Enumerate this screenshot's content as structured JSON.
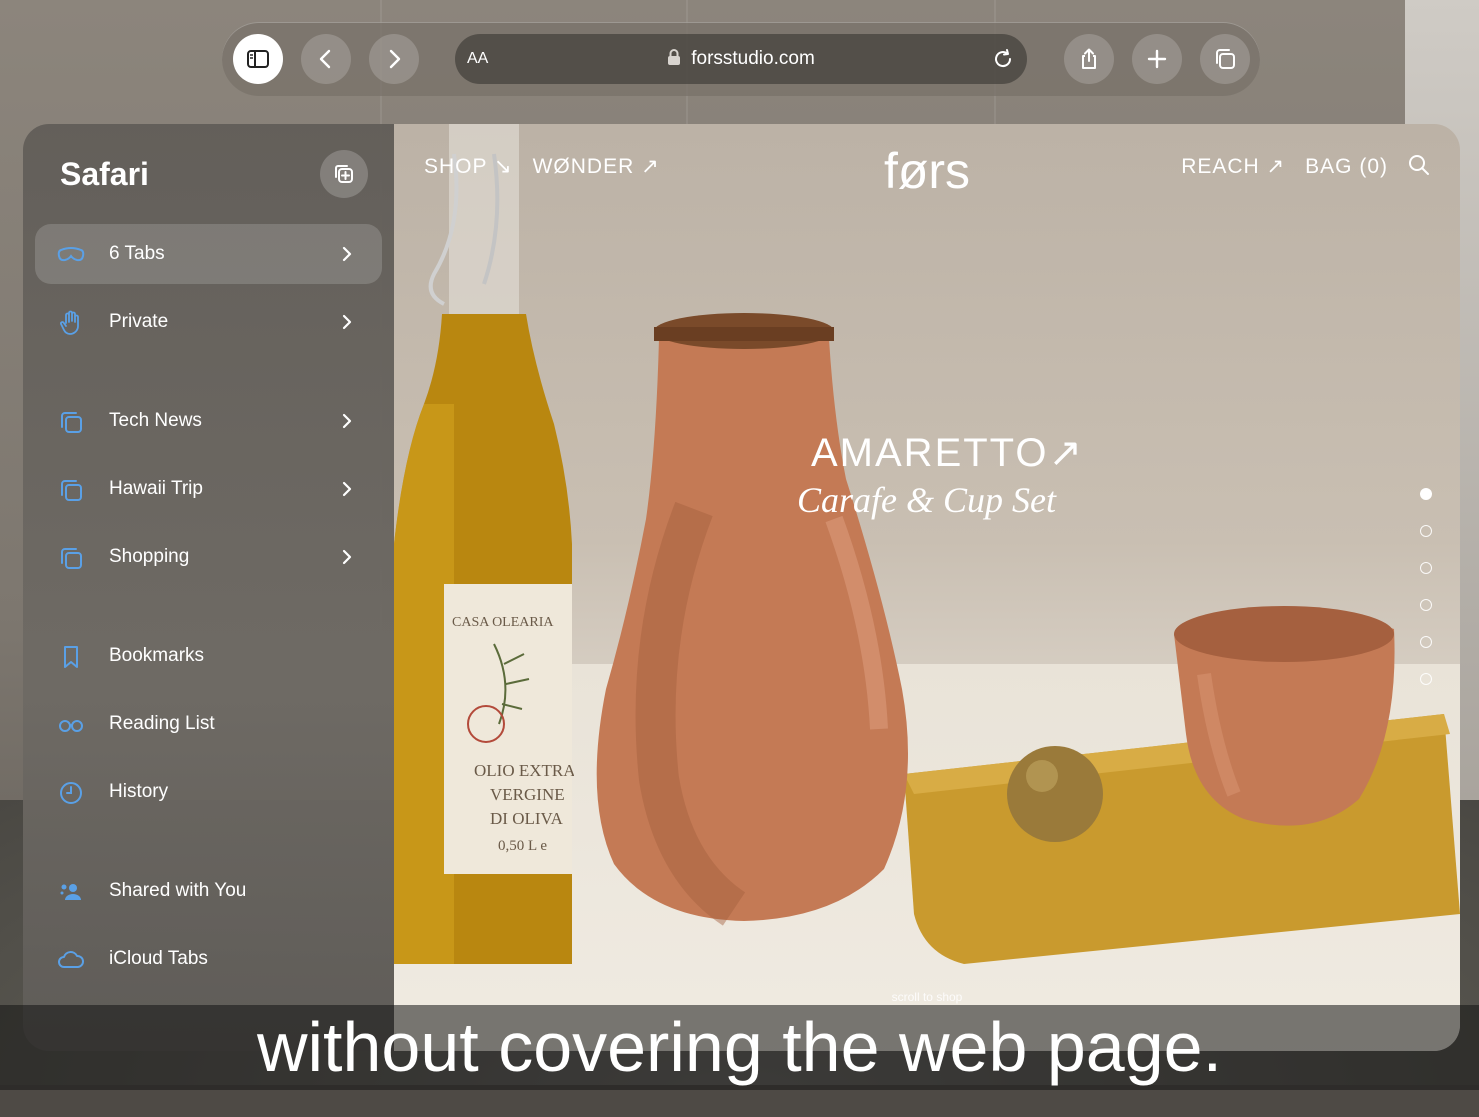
{
  "browser": {
    "address": {
      "text_size_label": "AA",
      "url": "forsstudio.com"
    }
  },
  "sidebar": {
    "title": "Safari",
    "items": [
      {
        "label": "6 Tabs",
        "icon": "vision-tabs-icon",
        "chevron": true
      },
      {
        "label": "Private",
        "icon": "hand-icon",
        "chevron": true
      },
      {
        "label": "Tech News",
        "icon": "tab-group-icon",
        "chevron": true
      },
      {
        "label": "Hawaii Trip",
        "icon": "tab-group-icon",
        "chevron": true
      },
      {
        "label": "Shopping",
        "icon": "tab-group-icon",
        "chevron": true
      },
      {
        "label": "Bookmarks",
        "icon": "bookmark-icon",
        "chevron": false
      },
      {
        "label": "Reading List",
        "icon": "glasses-icon",
        "chevron": false
      },
      {
        "label": "History",
        "icon": "clock-icon",
        "chevron": false
      },
      {
        "label": "Shared with You",
        "icon": "shared-people-icon",
        "chevron": false
      },
      {
        "label": "iCloud Tabs",
        "icon": "cloud-icon",
        "chevron": false
      }
    ]
  },
  "site": {
    "nav_left": [
      "SHOP ↘",
      "WØNDER ↗"
    ],
    "logo": "førs",
    "nav_right": [
      "REACH ↗",
      "BAG (0)"
    ],
    "hero_title": "AMARETTO↗",
    "hero_subtitle": "Carafe & Cup Set",
    "bottle_label_lines": [
      "CASA OLEARIA",
      "OLIO EXTRA",
      "VERGINE",
      "DI OLIVA",
      "0,50 L e"
    ],
    "scroll_hint": "scroll to shop",
    "slide_count": 6,
    "active_slide": 1
  },
  "caption": "without covering the web page.",
  "colors": {
    "accent": "#5aa0e6",
    "terracotta": "#c47a55",
    "mustard": "#c99a2e"
  }
}
